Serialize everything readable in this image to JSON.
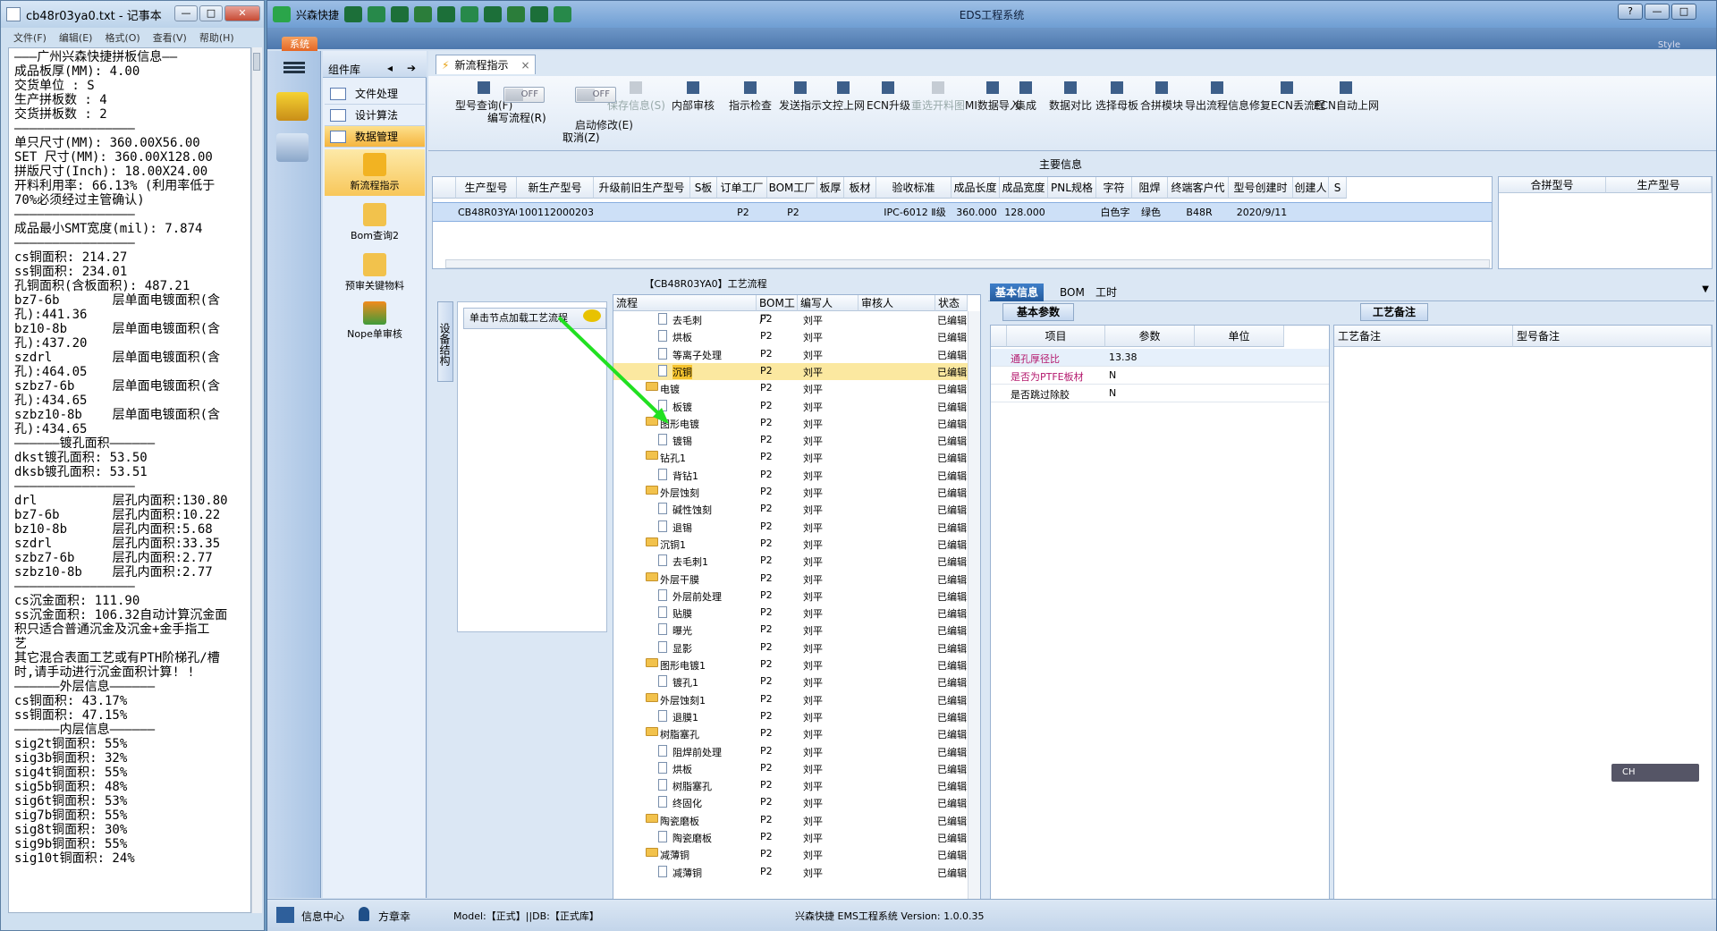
{
  "notepad": {
    "title": "cb48r03ya0.txt - 记事本",
    "menus": [
      "文件(F)",
      "编辑(E)",
      "格式(O)",
      "查看(V)",
      "帮助(H)"
    ],
    "minimize": "—",
    "maximize": "□",
    "close": "✕",
    "lines": [
      "———广州兴森快捷拼板信息——",
      "成品板厚(MM): 4.00",
      "交货单位 : S",
      "生产拼板数 : 4",
      "交货拼板数 : 2",
      "————————————————",
      "单只尺寸(MM): 360.00X56.00",
      "SET 尺寸(MM): 360.00X128.00",
      "拼版尺寸(Inch): 18.00X24.00",
      "开料利用率: 66.13% (利用率低于",
      "70%必须经过主管确认)",
      "————————————————",
      "成品最小SMT宽度(mil): 7.874",
      "————————————————",
      "cs铜面积: 214.27",
      "ss铜面积: 234.01",
      "孔铜面积(含板面积): 487.21",
      "bz7-6b       层单面电镀面积(含",
      "孔):441.36",
      "bz10-8b      层单面电镀面积(含",
      "孔):437.20",
      "szdrl        层单面电镀面积(含",
      "孔):464.05",
      "szbz7-6b     层单面电镀面积(含",
      "孔):434.65",
      "szbz10-8b    层单面电镀面积(含",
      "孔):434.65",
      "",
      "——————镀孔面积——————",
      "dkst镀孔面积: 53.50",
      "dksb镀孔面积: 53.51",
      "",
      "————————————————",
      "drl          层孔内面积:130.80",
      "bz7-6b       层孔内面积:10.22",
      "bz10-8b      层孔内面积:5.68",
      "szdrl        层孔内面积:33.35",
      "szbz7-6b     层孔内面积:2.77",
      "szbz10-8b    层孔内面积:2.77",
      "",
      "————————————————",
      "cs沉金面积: 111.90",
      "ss沉金面积: 106.32自动计算沉金面",
      "积只适合普通沉金及沉金+金手指工",
      "艺",
      "其它混合表面工艺或有PTH阶梯孔/槽",
      "时,请手动进行沉金面积计算! !",
      "——————外层信息——————",
      "cs铜面积: 43.17%",
      "ss铜面积: 47.15%",
      "——————内层信息——————",
      "sig2t铜面积: 55%",
      "sig3b铜面积: 32%",
      "sig4t铜面积: 55%",
      "sig5b铜面积: 48%",
      "sig6t铜面积: 53%",
      "sig7b铜面积: 55%",
      "sig8t铜面积: 30%",
      "sig9b铜面积: 55%",
      "sig10t铜面积: 24%"
    ]
  },
  "app": {
    "title": "EDS工程系统",
    "brand": "兴森快捷",
    "system_tab": "系统",
    "style_label": "Style",
    "component_lib": "组件库",
    "components": [
      "文件处理",
      "设计算法",
      "数据管理"
    ],
    "big_components": [
      "新流程指示",
      "Bom查询2",
      "预审关键物料",
      "Nope单审核"
    ],
    "doc_tab": "新流程指示",
    "toolbar": [
      {
        "label": "型号查询(F)",
        "dis": false
      },
      {
        "label": "启动修改(E)",
        "dis": false
      },
      {
        "label": "保存信息(S)",
        "dis": true
      },
      {
        "label": "内部审核",
        "dis": false
      },
      {
        "label": "指示检查",
        "dis": false
      },
      {
        "label": "发送指示",
        "dis": false
      },
      {
        "label": "文控上网",
        "dis": false
      },
      {
        "label": "ECN升级",
        "dis": false
      },
      {
        "label": "重选开料图",
        "dis": true
      },
      {
        "label": "MI数据导入",
        "dis": false
      },
      {
        "label": "集成",
        "dis": false
      },
      {
        "label": "数据对比",
        "dis": false
      },
      {
        "label": "选择母板",
        "dis": false
      },
      {
        "label": "合拼模块",
        "dis": false
      },
      {
        "label": "导出流程信息",
        "dis": false
      },
      {
        "label": "修复ECN丢流程",
        "dis": false
      },
      {
        "label": "ECN自动上网",
        "dis": false
      }
    ],
    "toggles": [
      {
        "state": "OFF",
        "label": "编写流程(R)"
      },
      {
        "state": "OFF",
        "label": "启动修改(E)"
      }
    ],
    "cancel_label": "取消(Z)",
    "main_info": "主要信息",
    "grid_headers": [
      "生产型号",
      "新生产型号",
      "升级前旧生产型号",
      "S板",
      "订单工厂",
      "BOM工厂",
      "板厚",
      "板材",
      "验收标准",
      "成品长度",
      "成品宽度",
      "PNL规格",
      "字符",
      "阻焊",
      "终端客户代码",
      "型号创建时间",
      "创建人",
      "S"
    ],
    "grid_row": [
      "CB48R03YA0",
      "10011200020368",
      "",
      "",
      "P2",
      "P2",
      "",
      "",
      "IPC-6012 Ⅱ级",
      "360.000",
      "128.000",
      "",
      "白色字符",
      "绿色",
      "B48R",
      "2020/9/11",
      "",
      ""
    ],
    "grid2_headers": [
      "合拼型号",
      "生产型号"
    ],
    "flow_title": "【CB48R03YA0】工艺流程",
    "side_tab": "设备结构",
    "hint": "单击节点加载工艺流程",
    "tree_headers": [
      "流程",
      "BOM工厂",
      "编写人",
      "审核人",
      "状态"
    ],
    "tree_rows": [
      {
        "name": "去毛刺",
        "lvl": 2,
        "bom": "P2",
        "writer": "刘平",
        "status": "已编辑"
      },
      {
        "name": "烘板",
        "lvl": 2,
        "bom": "P2",
        "writer": "刘平",
        "status": "已编辑"
      },
      {
        "name": "等离子处理",
        "lvl": 2,
        "bom": "P2",
        "writer": "刘平",
        "status": "已编辑"
      },
      {
        "name": "沉铜",
        "lvl": 2,
        "bom": "P2",
        "writer": "刘平",
        "status": "已编辑",
        "sel": true
      },
      {
        "name": "电镀",
        "lvl": 1,
        "bom": "P2",
        "writer": "刘平",
        "status": "已编辑"
      },
      {
        "name": "板镀",
        "lvl": 2,
        "bom": "P2",
        "writer": "刘平",
        "status": "已编辑"
      },
      {
        "name": "图形电镀",
        "lvl": 1,
        "bom": "P2",
        "writer": "刘平",
        "status": "已编辑"
      },
      {
        "name": "镀锡",
        "lvl": 2,
        "bom": "P2",
        "writer": "刘平",
        "status": "已编辑"
      },
      {
        "name": "钻孔1",
        "lvl": 1,
        "bom": "P2",
        "writer": "刘平",
        "status": "已编辑"
      },
      {
        "name": "背钻1",
        "lvl": 2,
        "bom": "P2",
        "writer": "刘平",
        "status": "已编辑"
      },
      {
        "name": "外层蚀刻",
        "lvl": 1,
        "bom": "P2",
        "writer": "刘平",
        "status": "已编辑"
      },
      {
        "name": "碱性蚀刻",
        "lvl": 2,
        "bom": "P2",
        "writer": "刘平",
        "status": "已编辑"
      },
      {
        "name": "退锡",
        "lvl": 2,
        "bom": "P2",
        "writer": "刘平",
        "status": "已编辑"
      },
      {
        "name": "沉铜1",
        "lvl": 1,
        "bom": "P2",
        "writer": "刘平",
        "status": "已编辑"
      },
      {
        "name": "去毛刺1",
        "lvl": 2,
        "bom": "P2",
        "writer": "刘平",
        "status": "已编辑"
      },
      {
        "name": "外层干膜",
        "lvl": 1,
        "bom": "P2",
        "writer": "刘平",
        "status": "已编辑"
      },
      {
        "name": "外层前处理",
        "lvl": 2,
        "bom": "P2",
        "writer": "刘平",
        "status": "已编辑"
      },
      {
        "name": "贴膜",
        "lvl": 2,
        "bom": "P2",
        "writer": "刘平",
        "status": "已编辑"
      },
      {
        "name": "曝光",
        "lvl": 2,
        "bom": "P2",
        "writer": "刘平",
        "status": "已编辑"
      },
      {
        "name": "显影",
        "lvl": 2,
        "bom": "P2",
        "writer": "刘平",
        "status": "已编辑"
      },
      {
        "name": "图形电镀1",
        "lvl": 1,
        "bom": "P2",
        "writer": "刘平",
        "status": "已编辑"
      },
      {
        "name": "镀孔1",
        "lvl": 2,
        "bom": "P2",
        "writer": "刘平",
        "status": "已编辑"
      },
      {
        "name": "外层蚀刻1",
        "lvl": 1,
        "bom": "P2",
        "writer": "刘平",
        "status": "已编辑"
      },
      {
        "name": "退膜1",
        "lvl": 2,
        "bom": "P2",
        "writer": "刘平",
        "status": "已编辑"
      },
      {
        "name": "树脂塞孔",
        "lvl": 1,
        "bom": "P2",
        "writer": "刘平",
        "status": "已编辑"
      },
      {
        "name": "阻焊前处理",
        "lvl": 2,
        "bom": "P2",
        "writer": "刘平",
        "status": "已编辑"
      },
      {
        "name": "烘板",
        "lvl": 2,
        "bom": "P2",
        "writer": "刘平",
        "status": "已编辑"
      },
      {
        "name": "树脂塞孔",
        "lvl": 2,
        "bom": "P2",
        "writer": "刘平",
        "status": "已编辑"
      },
      {
        "name": "终固化",
        "lvl": 2,
        "bom": "P2",
        "writer": "刘平",
        "status": "已编辑"
      },
      {
        "name": "陶瓷磨板",
        "lvl": 1,
        "bom": "P2",
        "writer": "刘平",
        "status": "已编辑"
      },
      {
        "name": "陶瓷磨板",
        "lvl": 2,
        "bom": "P2",
        "writer": "刘平",
        "status": "已编辑"
      },
      {
        "name": "减薄铜",
        "lvl": 1,
        "bom": "P2",
        "writer": "刘平",
        "status": "已编辑"
      },
      {
        "name": "减薄铜",
        "lvl": 2,
        "bom": "P2",
        "writer": "刘平",
        "status": "已编辑"
      }
    ],
    "right_tabs": [
      "基本信息",
      "BOM",
      "工时"
    ],
    "basic_params_tab": "基本参数",
    "param_headers": [
      "项目",
      "参数",
      "单位"
    ],
    "params": [
      {
        "item": "通孔厚径比",
        "value": "13.38",
        "color": "#b4196e"
      },
      {
        "item": "是否为PTFE板材",
        "value": "N",
        "color": "#b4196e"
      },
      {
        "item": "是否跳过除胶",
        "value": "N",
        "color": "#000000"
      }
    ],
    "craft_tab": "工艺备注",
    "craft_headers": [
      "工艺备注",
      "型号备注"
    ],
    "status": {
      "info_center": "信息中心",
      "user": "方章幸",
      "model_db": "Model:【正式】||DB:【正式库】",
      "version": "兴森快捷 EMS工程系统 Version: 1.0.0.35"
    },
    "ime": "CH"
  }
}
